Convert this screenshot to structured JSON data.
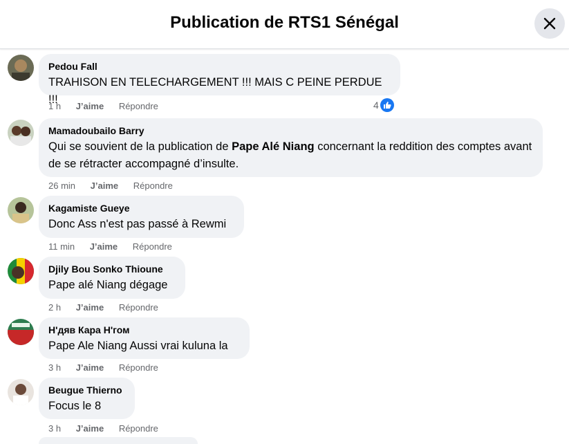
{
  "header": {
    "title": "Publication de RTS1 Sénégal"
  },
  "comments": [
    {
      "author": "Pedou Fall",
      "text": "TRAHISON EN TELECHARGEMENT !!! MAIS C PEINE PERDUE !!!",
      "time": "1 h",
      "like_label": "J’aime",
      "reply_label": "Répondre",
      "reaction_count": "4"
    },
    {
      "author": "Mamadoubailo Barry",
      "text_before": "Qui se souvient de la publication de ",
      "text_mention": "Pape Alé Niang",
      "text_after": " concernant la reddition des comptes avant de se rétracter accompagné d’insulte.",
      "time": "26 min",
      "like_label": "J’aime",
      "reply_label": "Répondre"
    },
    {
      "author": "Kagamiste Gueye",
      "text": "Donc Ass n'est pas passé à Rewmi",
      "time": "11 min",
      "like_label": "J’aime",
      "reply_label": "Répondre"
    },
    {
      "author": "Djily Bou Sonko Thioune",
      "text": "Pape alé Niang dégage",
      "time": "2 h",
      "like_label": "J’aime",
      "reply_label": "Répondre"
    },
    {
      "author": "Н'дяв Кара Н'гом",
      "text": "Pape Ale Niang Aussi vrai kuluna la",
      "time": "3 h",
      "like_label": "J’aime",
      "reply_label": "Répondre"
    },
    {
      "author": "Beugue Thierno",
      "text": "Focus le 8",
      "time": "3 h",
      "like_label": "J’aime",
      "reply_label": "Répondre"
    }
  ],
  "colors": {
    "like_blue": "#1877f2",
    "bubble_bg": "#f0f2f5",
    "meta_gray": "#65676b"
  },
  "icons": {
    "close": "close-icon",
    "like": "thumbs-up-icon"
  }
}
